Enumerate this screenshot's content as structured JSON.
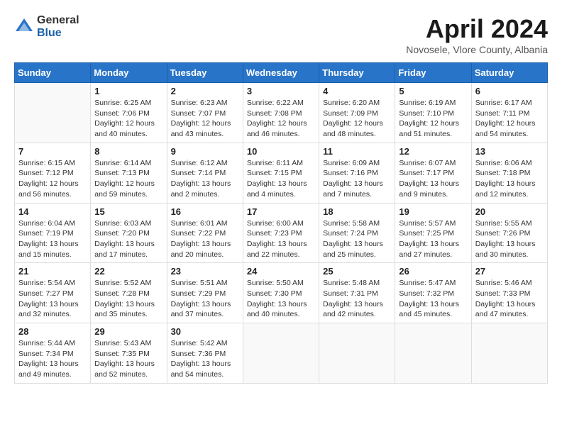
{
  "logo": {
    "general": "General",
    "blue": "Blue"
  },
  "title": "April 2024",
  "subtitle": "Novosele, Vlore County, Albania",
  "weekdays": [
    "Sunday",
    "Monday",
    "Tuesday",
    "Wednesday",
    "Thursday",
    "Friday",
    "Saturday"
  ],
  "weeks": [
    [
      {
        "day": "",
        "info": ""
      },
      {
        "day": "1",
        "info": "Sunrise: 6:25 AM\nSunset: 7:06 PM\nDaylight: 12 hours\nand 40 minutes."
      },
      {
        "day": "2",
        "info": "Sunrise: 6:23 AM\nSunset: 7:07 PM\nDaylight: 12 hours\nand 43 minutes."
      },
      {
        "day": "3",
        "info": "Sunrise: 6:22 AM\nSunset: 7:08 PM\nDaylight: 12 hours\nand 46 minutes."
      },
      {
        "day": "4",
        "info": "Sunrise: 6:20 AM\nSunset: 7:09 PM\nDaylight: 12 hours\nand 48 minutes."
      },
      {
        "day": "5",
        "info": "Sunrise: 6:19 AM\nSunset: 7:10 PM\nDaylight: 12 hours\nand 51 minutes."
      },
      {
        "day": "6",
        "info": "Sunrise: 6:17 AM\nSunset: 7:11 PM\nDaylight: 12 hours\nand 54 minutes."
      }
    ],
    [
      {
        "day": "7",
        "info": "Sunrise: 6:15 AM\nSunset: 7:12 PM\nDaylight: 12 hours\nand 56 minutes."
      },
      {
        "day": "8",
        "info": "Sunrise: 6:14 AM\nSunset: 7:13 PM\nDaylight: 12 hours\nand 59 minutes."
      },
      {
        "day": "9",
        "info": "Sunrise: 6:12 AM\nSunset: 7:14 PM\nDaylight: 13 hours\nand 2 minutes."
      },
      {
        "day": "10",
        "info": "Sunrise: 6:11 AM\nSunset: 7:15 PM\nDaylight: 13 hours\nand 4 minutes."
      },
      {
        "day": "11",
        "info": "Sunrise: 6:09 AM\nSunset: 7:16 PM\nDaylight: 13 hours\nand 7 minutes."
      },
      {
        "day": "12",
        "info": "Sunrise: 6:07 AM\nSunset: 7:17 PM\nDaylight: 13 hours\nand 9 minutes."
      },
      {
        "day": "13",
        "info": "Sunrise: 6:06 AM\nSunset: 7:18 PM\nDaylight: 13 hours\nand 12 minutes."
      }
    ],
    [
      {
        "day": "14",
        "info": "Sunrise: 6:04 AM\nSunset: 7:19 PM\nDaylight: 13 hours\nand 15 minutes."
      },
      {
        "day": "15",
        "info": "Sunrise: 6:03 AM\nSunset: 7:20 PM\nDaylight: 13 hours\nand 17 minutes."
      },
      {
        "day": "16",
        "info": "Sunrise: 6:01 AM\nSunset: 7:22 PM\nDaylight: 13 hours\nand 20 minutes."
      },
      {
        "day": "17",
        "info": "Sunrise: 6:00 AM\nSunset: 7:23 PM\nDaylight: 13 hours\nand 22 minutes."
      },
      {
        "day": "18",
        "info": "Sunrise: 5:58 AM\nSunset: 7:24 PM\nDaylight: 13 hours\nand 25 minutes."
      },
      {
        "day": "19",
        "info": "Sunrise: 5:57 AM\nSunset: 7:25 PM\nDaylight: 13 hours\nand 27 minutes."
      },
      {
        "day": "20",
        "info": "Sunrise: 5:55 AM\nSunset: 7:26 PM\nDaylight: 13 hours\nand 30 minutes."
      }
    ],
    [
      {
        "day": "21",
        "info": "Sunrise: 5:54 AM\nSunset: 7:27 PM\nDaylight: 13 hours\nand 32 minutes."
      },
      {
        "day": "22",
        "info": "Sunrise: 5:52 AM\nSunset: 7:28 PM\nDaylight: 13 hours\nand 35 minutes."
      },
      {
        "day": "23",
        "info": "Sunrise: 5:51 AM\nSunset: 7:29 PM\nDaylight: 13 hours\nand 37 minutes."
      },
      {
        "day": "24",
        "info": "Sunrise: 5:50 AM\nSunset: 7:30 PM\nDaylight: 13 hours\nand 40 minutes."
      },
      {
        "day": "25",
        "info": "Sunrise: 5:48 AM\nSunset: 7:31 PM\nDaylight: 13 hours\nand 42 minutes."
      },
      {
        "day": "26",
        "info": "Sunrise: 5:47 AM\nSunset: 7:32 PM\nDaylight: 13 hours\nand 45 minutes."
      },
      {
        "day": "27",
        "info": "Sunrise: 5:46 AM\nSunset: 7:33 PM\nDaylight: 13 hours\nand 47 minutes."
      }
    ],
    [
      {
        "day": "28",
        "info": "Sunrise: 5:44 AM\nSunset: 7:34 PM\nDaylight: 13 hours\nand 49 minutes."
      },
      {
        "day": "29",
        "info": "Sunrise: 5:43 AM\nSunset: 7:35 PM\nDaylight: 13 hours\nand 52 minutes."
      },
      {
        "day": "30",
        "info": "Sunrise: 5:42 AM\nSunset: 7:36 PM\nDaylight: 13 hours\nand 54 minutes."
      },
      {
        "day": "",
        "info": ""
      },
      {
        "day": "",
        "info": ""
      },
      {
        "day": "",
        "info": ""
      },
      {
        "day": "",
        "info": ""
      }
    ]
  ]
}
